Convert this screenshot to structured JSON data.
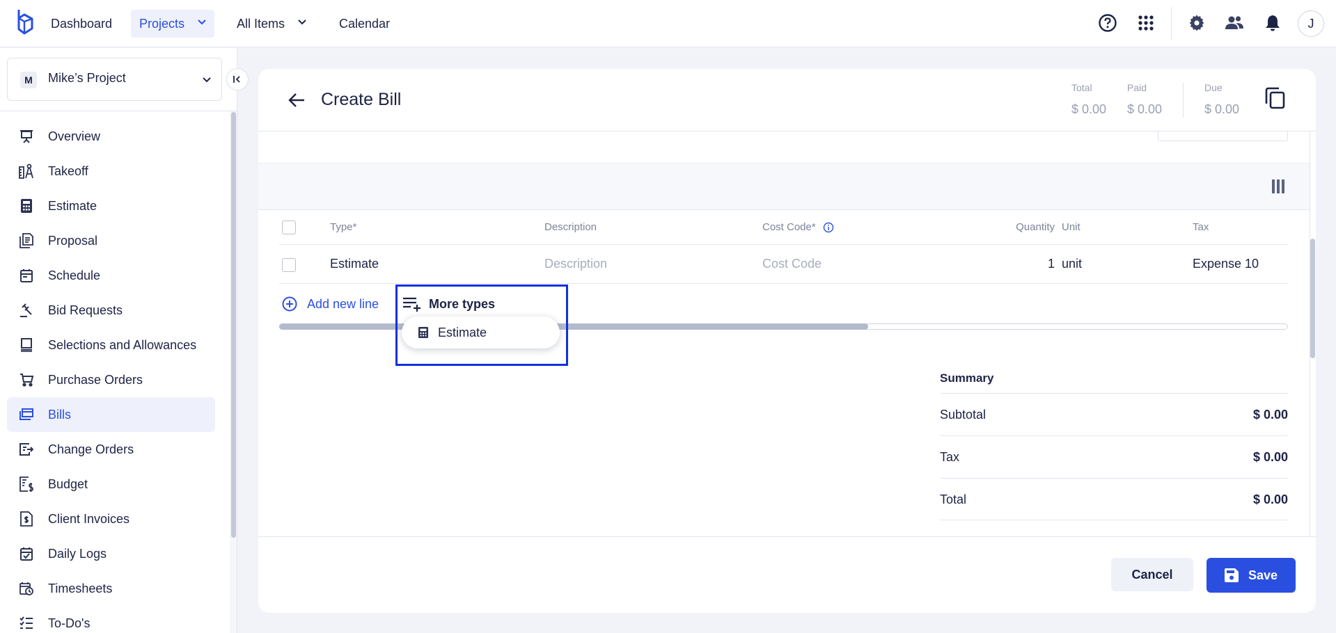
{
  "topnav": {
    "logo": "buildern-logo",
    "items": [
      {
        "label": "Dashboard"
      },
      {
        "label": "Projects"
      },
      {
        "label": "All Items"
      },
      {
        "label": "Calendar"
      }
    ],
    "icons": [
      "help-circle-icon",
      "apps-grid-icon",
      "settings-gear-icon",
      "people-icon",
      "bell-icon"
    ],
    "avatar_initial": "J"
  },
  "sidebar": {
    "project_badge": "M",
    "project_name": "Mike’s Project",
    "items": [
      {
        "label": "Overview",
        "icon": "presentation-board-icon"
      },
      {
        "label": "Takeoff",
        "icon": "takeoff-measure-icon"
      },
      {
        "label": "Estimate",
        "icon": "calculator-icon"
      },
      {
        "label": "Proposal",
        "icon": "proposal-document-icon"
      },
      {
        "label": "Schedule",
        "icon": "calendar-icon"
      },
      {
        "label": "Bid Requests",
        "icon": "gavel-icon"
      },
      {
        "label": "Selections and Allowances",
        "icon": "selections-icon"
      },
      {
        "label": "Purchase Orders",
        "icon": "cart-icon"
      },
      {
        "label": "Bills",
        "icon": "bill-card-icon"
      },
      {
        "label": "Change Orders",
        "icon": "change-order-icon"
      },
      {
        "label": "Budget",
        "icon": "budget-icon"
      },
      {
        "label": "Client Invoices",
        "icon": "invoice-dollar-icon"
      },
      {
        "label": "Daily Logs",
        "icon": "calendar-check-icon"
      },
      {
        "label": "Timesheets",
        "icon": "timesheet-clock-icon"
      },
      {
        "label": "To-Do's",
        "icon": "checklist-icon"
      }
    ],
    "active_item": "Bills"
  },
  "header": {
    "title": "Create Bill",
    "stats": [
      {
        "label": "Total",
        "value": "$ 0.00"
      },
      {
        "label": "Paid",
        "value": "$ 0.00"
      },
      {
        "label": "Due",
        "value": "$ 0.00"
      }
    ]
  },
  "table": {
    "columns": [
      "Type*",
      "Description",
      "Cost Code*",
      "Quantity",
      "Unit",
      "Tax"
    ],
    "rows": [
      {
        "type": "Estimate",
        "description_placeholder": "Description",
        "cost_code_placeholder": "Cost Code",
        "quantity": "1",
        "unit": "unit",
        "tax": "Expense 10"
      }
    ]
  },
  "actions": {
    "add_new_line": "Add new line",
    "more_types": "More types",
    "more_types_options": [
      "Estimate"
    ]
  },
  "summary": {
    "title": "Summary",
    "rows": [
      {
        "label": "Subtotal",
        "value": "$ 0.00"
      },
      {
        "label": "Tax",
        "value": "$ 0.00"
      },
      {
        "label": "Total",
        "value": "$ 0.00"
      }
    ]
  },
  "footer": {
    "cancel": "Cancel",
    "save": "Save"
  },
  "colors": {
    "accent": "#2a4fe0",
    "text": "#1d2345",
    "highlight": "#1230e0"
  }
}
